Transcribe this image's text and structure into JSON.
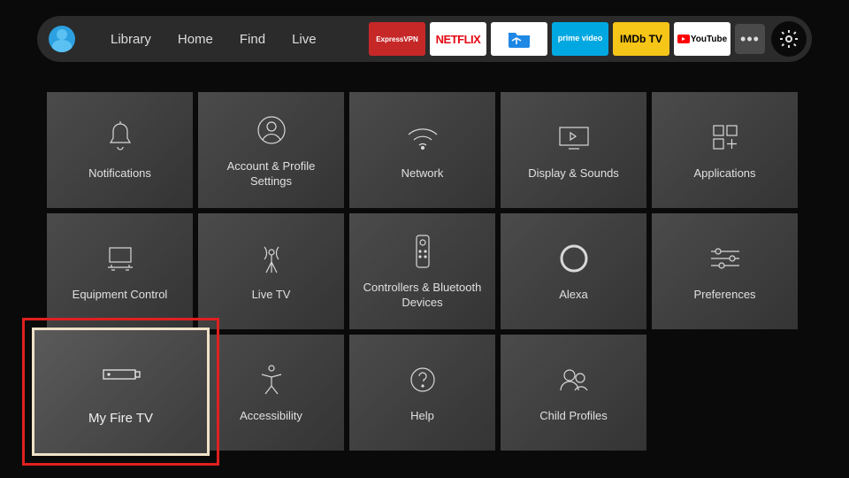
{
  "nav": {
    "library": "Library",
    "home": "Home",
    "find": "Find",
    "live": "Live"
  },
  "apps": {
    "express": "ExpressVPN",
    "netflix": "NETFLIX",
    "files": "📁",
    "prime": "prime video",
    "imdb": "IMDb TV",
    "youtube": "YouTube"
  },
  "settings_grid": [
    {
      "id": "notifications",
      "label": "Notifications"
    },
    {
      "id": "account",
      "label": "Account & Profile Settings"
    },
    {
      "id": "network",
      "label": "Network"
    },
    {
      "id": "display",
      "label": "Display & Sounds"
    },
    {
      "id": "applications",
      "label": "Applications"
    },
    {
      "id": "equipment",
      "label": "Equipment Control"
    },
    {
      "id": "livetv",
      "label": "Live TV"
    },
    {
      "id": "controllers",
      "label": "Controllers & Bluetooth Devices"
    },
    {
      "id": "alexa",
      "label": "Alexa"
    },
    {
      "id": "preferences",
      "label": "Preferences"
    },
    {
      "id": "myfiretv",
      "label": "My Fire TV"
    },
    {
      "id": "accessibility",
      "label": "Accessibility"
    },
    {
      "id": "help",
      "label": "Help"
    },
    {
      "id": "childprofiles",
      "label": "Child Profiles"
    }
  ],
  "selected": "myfiretv",
  "highlight_color": "#e02020"
}
